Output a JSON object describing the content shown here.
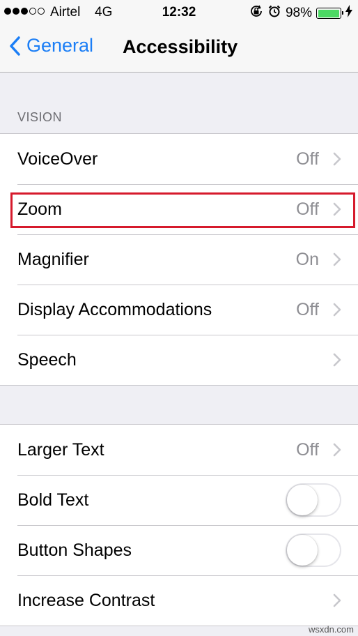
{
  "status_bar": {
    "carrier": "Airtel",
    "network": "4G",
    "time": "12:32",
    "battery_percent": "98%",
    "battery_level": 0.98,
    "icons": [
      "signal-icon",
      "orientation-lock-icon",
      "alarm-icon",
      "battery-icon",
      "charging-bolt-icon"
    ]
  },
  "nav": {
    "back_label": "General",
    "title": "Accessibility"
  },
  "vision": {
    "header": "VISION",
    "items": [
      {
        "label": "VoiceOver",
        "value": "Off"
      },
      {
        "label": "Zoom",
        "value": "Off"
      },
      {
        "label": "Magnifier",
        "value": "On"
      },
      {
        "label": "Display Accommodations",
        "value": "Off"
      },
      {
        "label": "Speech",
        "value": ""
      }
    ]
  },
  "interaction": {
    "items": [
      {
        "label": "Larger Text",
        "value": "Off"
      },
      {
        "label": "Bold Text",
        "toggle": false
      },
      {
        "label": "Button Shapes",
        "toggle": false
      },
      {
        "label": "Increase Contrast",
        "value": ""
      }
    ]
  },
  "watermark": "wsxdn.com",
  "colors": {
    "accent": "#1b7ef6",
    "highlight": "#d61a2c",
    "battery": "#4cd964"
  }
}
